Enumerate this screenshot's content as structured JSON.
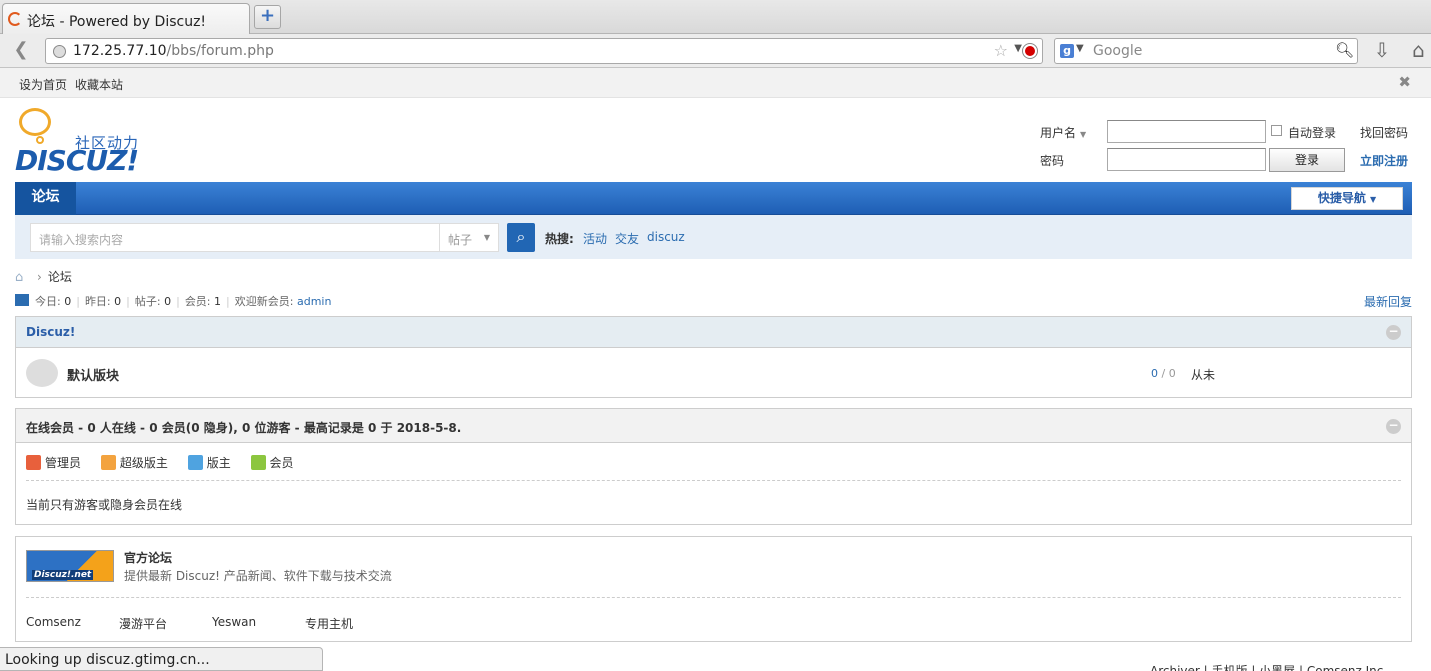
{
  "browser": {
    "tab_title": "论坛 - Powered by Discuz!",
    "new_tab": "+",
    "url_host": "172.25.77.10",
    "url_path": "/bbs/forum.php",
    "search_engine": "Google",
    "status_text": "Looking up discuz.gtimg.cn..."
  },
  "topbar": {
    "set_home": "设为首页",
    "bookmark": "收藏本站"
  },
  "logo": {
    "slogan": "社区动力",
    "word": "DISCUZ!"
  },
  "login": {
    "username_label": "用户名",
    "password_label": "密码",
    "auto_login": "自动登录",
    "login_button": "登录",
    "forgot": "找回密码",
    "register": "立即注册"
  },
  "nav": {
    "current": "论坛",
    "quick_nav": "快捷导航"
  },
  "search": {
    "placeholder": "请输入搜索内容",
    "scope": "帖子",
    "hot_label": "热搜:",
    "hot_terms": [
      "活动",
      "交友",
      "discuz"
    ]
  },
  "breadcrumb": {
    "current": "论坛"
  },
  "stats": {
    "today_label": "今日:",
    "today": "0",
    "yesterday_label": "昨日:",
    "yesterday": "0",
    "posts_label": "帖子:",
    "posts": "0",
    "members_label": "会员:",
    "members": "1",
    "welcome_label": "欢迎新会员:",
    "newest_member": "admin",
    "latest_reply": "最新回复"
  },
  "forum_group": {
    "title": "Discuz!",
    "forum_name": "默认版块",
    "threads": "0",
    "posts": "0",
    "last_post": "从未"
  },
  "online": {
    "title": "在线会员 - 0 人在线 - 0 会员(0 隐身), 0 位游客 - 最高记录是 0 于 2018-5-8.",
    "legend": [
      {
        "label": "管理员",
        "color": "#e8603c"
      },
      {
        "label": "超级版主",
        "color": "#f3a33f"
      },
      {
        "label": "版主",
        "color": "#4fa3e0"
      },
      {
        "label": "会员",
        "color": "#8cc63f"
      }
    ],
    "note": "当前只有游客或隐身会员在线"
  },
  "links": {
    "logo_text": "Discuz!.net",
    "title": "官方论坛",
    "desc": "提供最新 Discuz! 产品新闻、软件下载与技术交流",
    "text_links": [
      "Comsenz",
      "漫游平台",
      "Yeswan",
      "专用主机"
    ]
  },
  "footer": {
    "peek": "Archiver | 手机版 | 小黑屋 | Comsenz Inc."
  }
}
